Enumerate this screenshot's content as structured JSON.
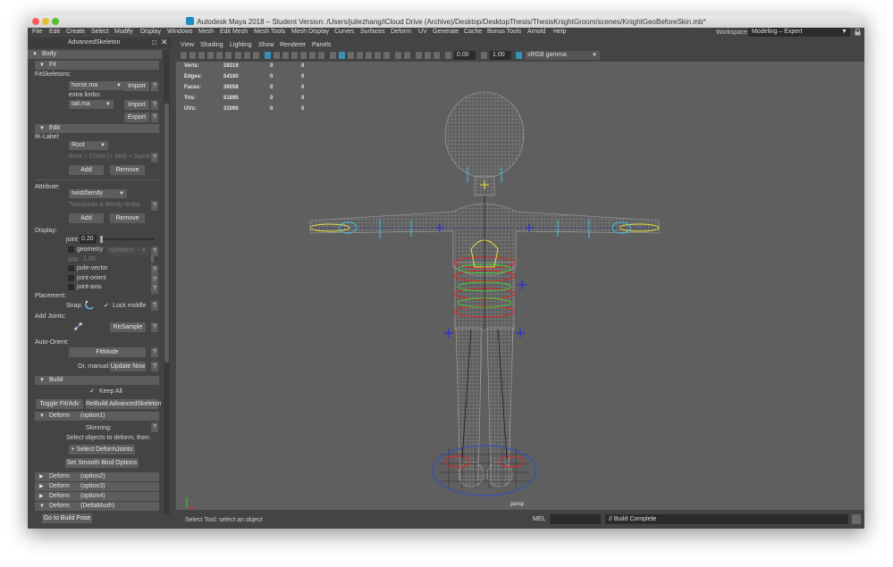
{
  "window": {
    "title": "Autodesk Maya 2018 – Student Version: /Users/juliezhang/iCloud Drive (Archive)/Desktop/DesktopThesis/ThesisKnightGroom/scenes/KnightGeoBeforeSkin.mb*",
    "traffic_colors": [
      "#fc5b57",
      "#e5bf3c",
      "#57c038"
    ]
  },
  "menubar": {
    "items": [
      "File",
      "Edit",
      "Create",
      "Select",
      "Modify",
      "Display",
      "Windows",
      "Mesh",
      "Edit Mesh",
      "Mesh Tools",
      "Mesh Display",
      "Curves",
      "Surfaces",
      "Deform",
      "UV",
      "Generate",
      "Cache",
      "Bonus Tools",
      "Arnold",
      "Help"
    ],
    "workspace_label": "Workspace :",
    "workspace_value": "Modeling – Expert"
  },
  "panel": {
    "title": "AdvancedSkeleton",
    "body_section": "Body",
    "fit_section": "Fit",
    "fitskeletons_label": "FitSkeletons:",
    "fitskeleton_value": "horse.ma",
    "import_label": "Import",
    "help_label": "?",
    "extra_limbs_label": "extra limbs:",
    "extra_limbs_value": "tail.ma",
    "export_label": "Export",
    "edit_section": "Edit",
    "iklabel_label": "IK-Label:",
    "iklabel_value": "Root",
    "iklabel_hint": "Root + Chest (+ Mid) + Spine IK",
    "add_label": "Add",
    "remove_label": "Remove",
    "attribute_label": "Attribute:",
    "attribute_value": "twist/bendy",
    "attribute_hint": "Twistjoints & Bendy-limbs",
    "display_label": "Display:",
    "joint_label": "joint",
    "joint_value": "0.20",
    "joint_slider_fraction": 0.2,
    "geometry_label": "geometry",
    "geometry_mode": "cylinders",
    "gap_label": "gap",
    "gap_value": "1.00",
    "pole_vector_label": "pole-vector",
    "joint_orient_label": "joint-orient",
    "joint_axis_label": "joint-axis",
    "placement_label": "Placement:",
    "snap_label": "Snap:",
    "lock_middle_label": "Lock middle",
    "add_joints_label": "Add Joints:",
    "resample_label": "ReSample",
    "auto_orient_label": "Auto-Orient:",
    "fitmode_label": "FitMode",
    "or_manual_label": "Or, manual:",
    "update_now_label": "Update Now",
    "build_section": "Build",
    "keep_all_label": "Keep All",
    "toggle_fit_label": "Toggle Fit/Adv",
    "rebuild_label": "ReBuild AdvancedSkeleton",
    "deform1_section": "Deform",
    "deform1_option": "(option1)",
    "skinning_label": "Skinning:",
    "select_objects_label": "Select objects to deform, then:",
    "select_deformjoints_label": "+ Select DeformJoints",
    "smooth_bind_label": "Set Smooth Bind Options",
    "deform2_section": "Deform",
    "deform2_option": "(option2)",
    "deform3_section": "Deform",
    "deform3_option": "(option3)",
    "deform4_section": "Deform",
    "deform4_option": "(option4)",
    "deform5_section": "Deform",
    "deform5_option": "(DeltaMush)",
    "go_to_build_pose": "Go to Build Pose"
  },
  "viewport": {
    "menu": [
      "View",
      "Shading",
      "Lighting",
      "Show",
      "Renderer",
      "Panels"
    ],
    "exposure_value": "0.00",
    "gamma_value": "1.00",
    "colorspace_value": "sRGB gamma",
    "hud": [
      {
        "label": "Verts:",
        "value": "28319",
        "sel": "0",
        "comp": "0"
      },
      {
        "label": "Edges:",
        "value": "54160",
        "sel": "0",
        "comp": "0"
      },
      {
        "label": "Faces:",
        "value": "26058",
        "sel": "0",
        "comp": "0"
      },
      {
        "label": "Tris:",
        "value": "51895",
        "sel": "0",
        "comp": "0"
      },
      {
        "label": "UVs:",
        "value": "31090",
        "sel": "0",
        "comp": "0"
      }
    ],
    "camera_label": "persp"
  },
  "statusbar": {
    "help_line": "Select Tool: select an object",
    "mel_label": "MEL",
    "result_text": "// Build Complete"
  },
  "colors": {
    "accent_blue": "#3a8fb7",
    "section_gray": "#5d5d5d",
    "viewport_bg": "#5f5f5f"
  }
}
